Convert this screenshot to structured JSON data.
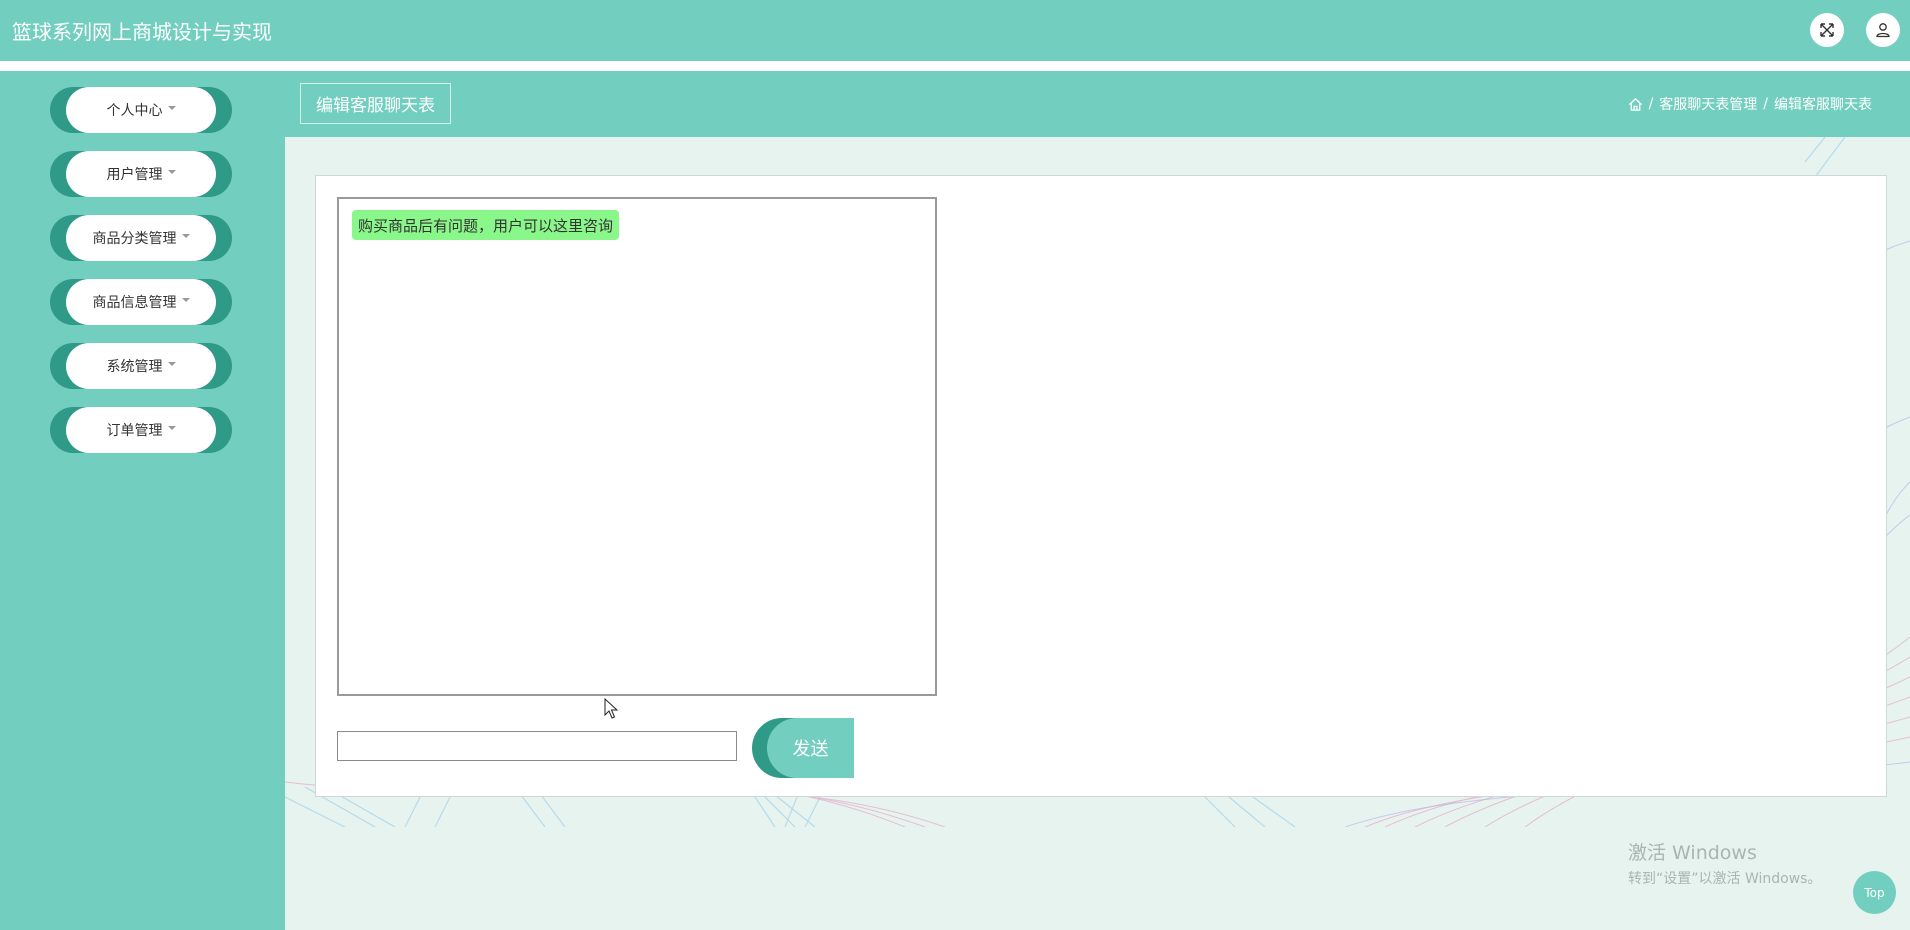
{
  "app": {
    "title": "篮球系列网上商城设计与实现"
  },
  "header": {
    "fullscreen_icon": "expand-icon",
    "user_icon": "user-icon"
  },
  "sidebar": {
    "items": [
      {
        "label": "个人中心"
      },
      {
        "label": "用户管理"
      },
      {
        "label": "商品分类管理"
      },
      {
        "label": "商品信息管理"
      },
      {
        "label": "系统管理"
      },
      {
        "label": "订单管理"
      }
    ]
  },
  "content": {
    "page_title": "编辑客服聊天表",
    "breadcrumb": {
      "home_icon": "home-icon",
      "items": [
        "客服聊天表管理",
        "编辑客服聊天表"
      ]
    }
  },
  "chat": {
    "messages": [
      {
        "text": "购买商品后有问题，用户可以这里咨询"
      }
    ],
    "input_value": "",
    "send_label": "发送"
  },
  "watermark": {
    "title": "激活 Windows",
    "subtitle": "转到“设置”以激活 Windows。"
  },
  "top_button": {
    "label": "Top"
  },
  "colors": {
    "accent": "#72cfc0",
    "accent_dark": "#2f9a87",
    "message_bg": "#8af78a"
  }
}
